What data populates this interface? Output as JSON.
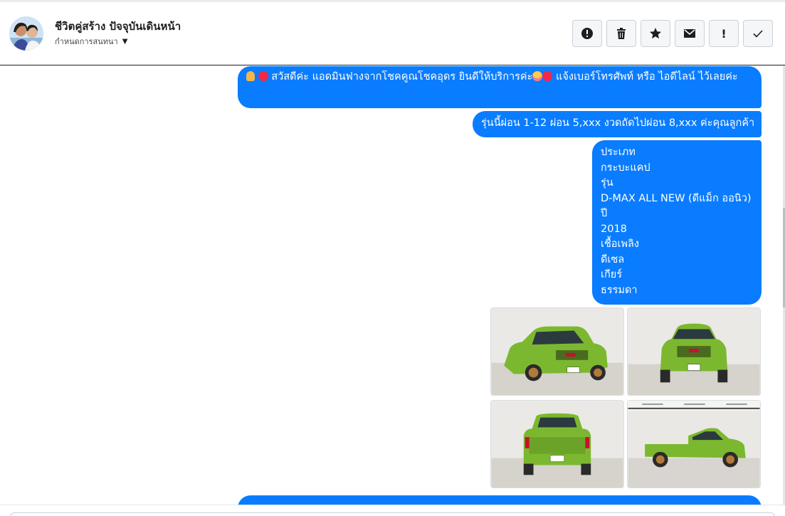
{
  "header": {
    "contact_name": "ชีวิตคู่สร้าง ปัจจุบันเดินหน้า",
    "subtitle": "กำหนดการสนทนา",
    "subtitle_icon": "caret-down-icon",
    "actions": [
      {
        "name": "report-spam",
        "icon": "alert-circle-icon"
      },
      {
        "name": "delete",
        "icon": "trash-icon"
      },
      {
        "name": "star",
        "icon": "star-icon"
      },
      {
        "name": "mark-unread",
        "icon": "envelope-icon"
      },
      {
        "name": "follow-up",
        "icon": "exclamation-icon",
        "glyph": "!"
      },
      {
        "name": "mark-done",
        "icon": "checkmark-icon"
      }
    ]
  },
  "messages": {
    "greeting": "สวัสดีค่ะ แอดมินฟางจากโชคคูณโชคอุดร ยินดีให้บริการค่ะ",
    "greeting_tail": "แจ้งเบอร์โทรศัพท์ หรือ ไอดีไลน์  ไว้เลยค่ะ",
    "installment": "รุ่นนี้ผ่อน 1-12 ผ่อน 5,xxx งวดถัดไปผ่อน 8,xxx ค่ะคุณลูกค้า",
    "specs": {
      "type_label": "ประเภท",
      "type_value": "กระบะแคป",
      "model_label": "รุ่น",
      "model_value": "D-MAX ALL NEW (ดีแม็ก ออนิว)",
      "year_label": "ปี",
      "year_value": "2018",
      "fuel_label": "เชื้อเพลิง",
      "fuel_value": "ดีเซล",
      "gear_label": "เกียร์",
      "gear_value": "ธรรมดา"
    },
    "photos": [
      {
        "name": "front-left",
        "desc": "green pickup front-left view"
      },
      {
        "name": "front",
        "desc": "green pickup front view"
      },
      {
        "name": "rear",
        "desc": "green pickup rear view"
      },
      {
        "name": "side",
        "desc": "green pickup side view"
      }
    ]
  },
  "colors": {
    "bubble": "#0a7cff",
    "car": "#7cb82f",
    "header_text": "#1c1e21"
  }
}
